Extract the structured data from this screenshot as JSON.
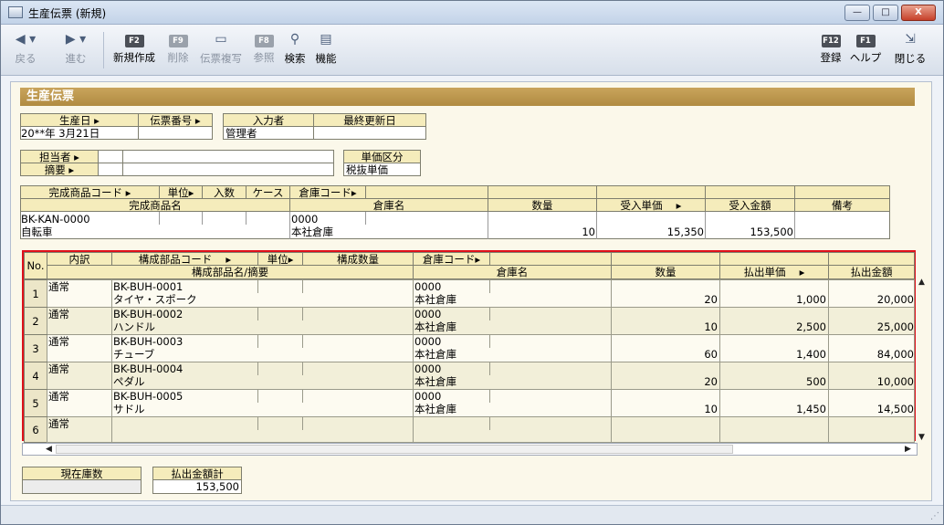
{
  "window": {
    "title": "生産伝票 (新規)",
    "min": "—",
    "max": "□",
    "close": "X"
  },
  "toolbar": {
    "back": "戻る",
    "forward": "進む",
    "new_key": "F2",
    "new": "新規作成",
    "delete_key": "F9",
    "delete": "削除",
    "copy": "伝票複写",
    "ref_key": "F8",
    "ref": "参照",
    "search": "検索",
    "func": "機能",
    "reg_key": "F12",
    "reg": "登録",
    "help_key": "F1",
    "help": "ヘルプ",
    "close": "閉じる"
  },
  "form": {
    "section_title": "生産伝票",
    "date_label": "生産日",
    "slip_no_label": "伝票番号",
    "input_by_label": "入力者",
    "last_update_label": "最終更新日",
    "date_value": "20**年 3月21日",
    "slip_no_value": "",
    "input_by_value": "管理者",
    "last_update_value": "",
    "person_label": "担当者",
    "summary_label": "摘要",
    "price_type_label": "単価区分",
    "price_type_value": "税抜単価"
  },
  "product": {
    "h_code": "完成商品コード",
    "h_unit": "単位",
    "h_qty": "入数",
    "h_case": "ケース",
    "h_wh_code": "倉庫コード",
    "h_name": "完成商品名",
    "h_wh_name": "倉庫名",
    "h_quantity": "数量",
    "h_unit_price": "受入単価",
    "h_amount": "受入金額",
    "h_note": "備考",
    "code": "BK-KAN-0000",
    "name": "自転車",
    "wh_code": "0000",
    "wh_name": "本社倉庫",
    "quantity": "10",
    "unit_price": "15,350",
    "amount": "153,500"
  },
  "grid": {
    "h_no": "No.",
    "h_type": "内訳",
    "h_code": "構成部品コード",
    "h_unit": "単位",
    "h_qty": "構成数量",
    "h_wh_code": "倉庫コード",
    "h_name": "構成部品名/摘要",
    "h_wh_name": "倉庫名",
    "h_quantity": "数量",
    "h_unit_price": "払出単価",
    "h_amount": "払出金額",
    "rows": [
      {
        "no": "1",
        "type": "通常",
        "code": "BK-BUH-0001",
        "name": "タイヤ・スポーク",
        "wh_code": "0000",
        "wh_name": "本社倉庫",
        "quantity": "20",
        "unit_price": "1,000",
        "amount": "20,000"
      },
      {
        "no": "2",
        "type": "通常",
        "code": "BK-BUH-0002",
        "name": "ハンドル",
        "wh_code": "0000",
        "wh_name": "本社倉庫",
        "quantity": "10",
        "unit_price": "2,500",
        "amount": "25,000"
      },
      {
        "no": "3",
        "type": "通常",
        "code": "BK-BUH-0003",
        "name": "チューブ",
        "wh_code": "0000",
        "wh_name": "本社倉庫",
        "quantity": "60",
        "unit_price": "1,400",
        "amount": "84,000"
      },
      {
        "no": "4",
        "type": "通常",
        "code": "BK-BUH-0004",
        "name": "ペダル",
        "wh_code": "0000",
        "wh_name": "本社倉庫",
        "quantity": "20",
        "unit_price": "500",
        "amount": "10,000"
      },
      {
        "no": "5",
        "type": "通常",
        "code": "BK-BUH-0005",
        "name": "サドル",
        "wh_code": "0000",
        "wh_name": "本社倉庫",
        "quantity": "10",
        "unit_price": "1,450",
        "amount": "14,500"
      },
      {
        "no": "6",
        "type": "通常",
        "code": "",
        "name": "",
        "wh_code": "",
        "wh_name": "",
        "quantity": "",
        "unit_price": "",
        "amount": ""
      }
    ]
  },
  "footer": {
    "stock_label": "現在庫数",
    "stock_value": "",
    "total_label": "払出金額計",
    "total_value": "153,500"
  },
  "colors": {
    "accent": "#b08b41",
    "grid_border": "#e0101a",
    "label_bg": "#f5ecbb"
  }
}
